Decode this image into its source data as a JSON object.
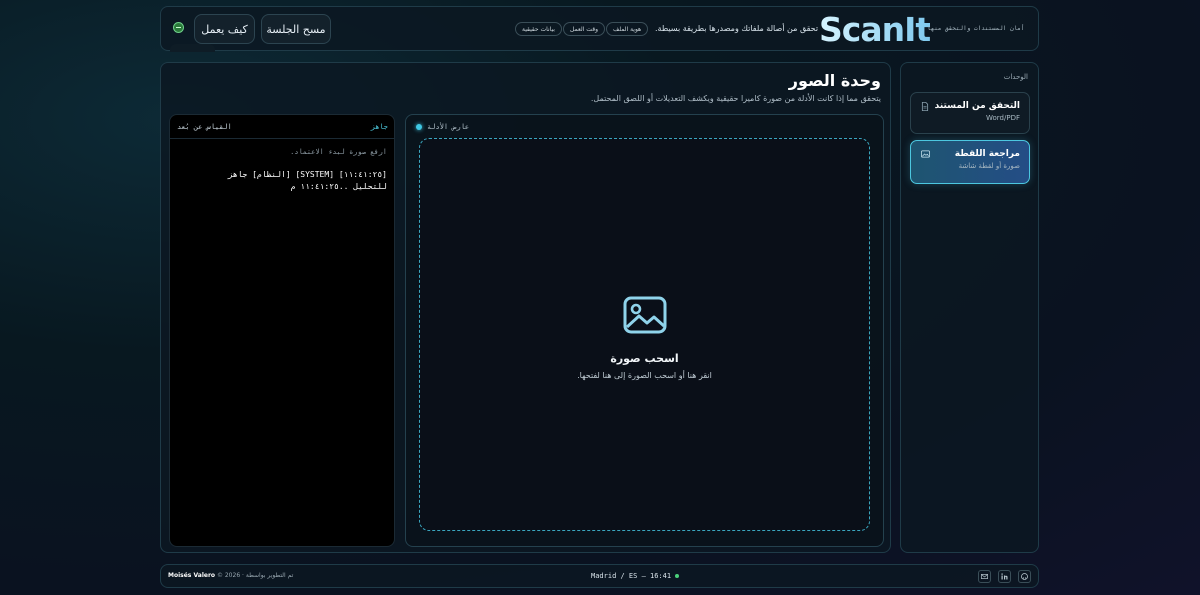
{
  "header": {
    "logo": "ScanIt",
    "subtitle": "أمان المستندات والتحقق منها",
    "tagline": "تحقق من أصالة ملفاتك ومصدرها بطريقة بسيطة.",
    "chips": [
      "بيانات حقيقية",
      "وقت العمل",
      "هوية الملف"
    ],
    "buttons": {
      "clear_session": "مسح الجلسة",
      "how_it_works": "كيف يعمل"
    }
  },
  "sidebar": {
    "title": "الوحدات",
    "modules": [
      {
        "title": "التحقق من المستند",
        "subtitle": "Word/PDF",
        "icon": "document-icon"
      },
      {
        "title": "مراجعة اللقطة",
        "subtitle": "صورة أو لقطة شاشة",
        "icon": "image-icon",
        "active": true
      }
    ]
  },
  "main": {
    "title": "وحدة الصور",
    "description": "يتحقق مما إذا كانت الأدلة من صورة كاميرا حقيقية ويكشف التعديلات أو اللصق المحتمل.",
    "viewer": {
      "label": "عارض الأدلة",
      "drop_title": "اسحب صورة",
      "drop_hint": "انقر هنا أو اسحب الصورة إلى هنا لفتحها."
    },
    "console": {
      "status": "جاهز",
      "label": "القياس عن بُعد",
      "hint": "ارفع صورة لبدء الاعتماد.",
      "log": "[١١:٤١:٢٥] [SYSTEM] [النظام] جاهز للتحليل ..١١:٤١:٢٥ م"
    }
  },
  "footer": {
    "copyright": "© 2026 · تم التطوير بواسطة",
    "author": "Moisés Valero",
    "location": "Madrid / ES — 16:41",
    "icons": [
      "github-icon",
      "linkedin-icon",
      "mail-icon"
    ]
  },
  "colors": {
    "accent": "#3fc8e4",
    "background": "#081820",
    "status_ok": "#4bd07a"
  }
}
